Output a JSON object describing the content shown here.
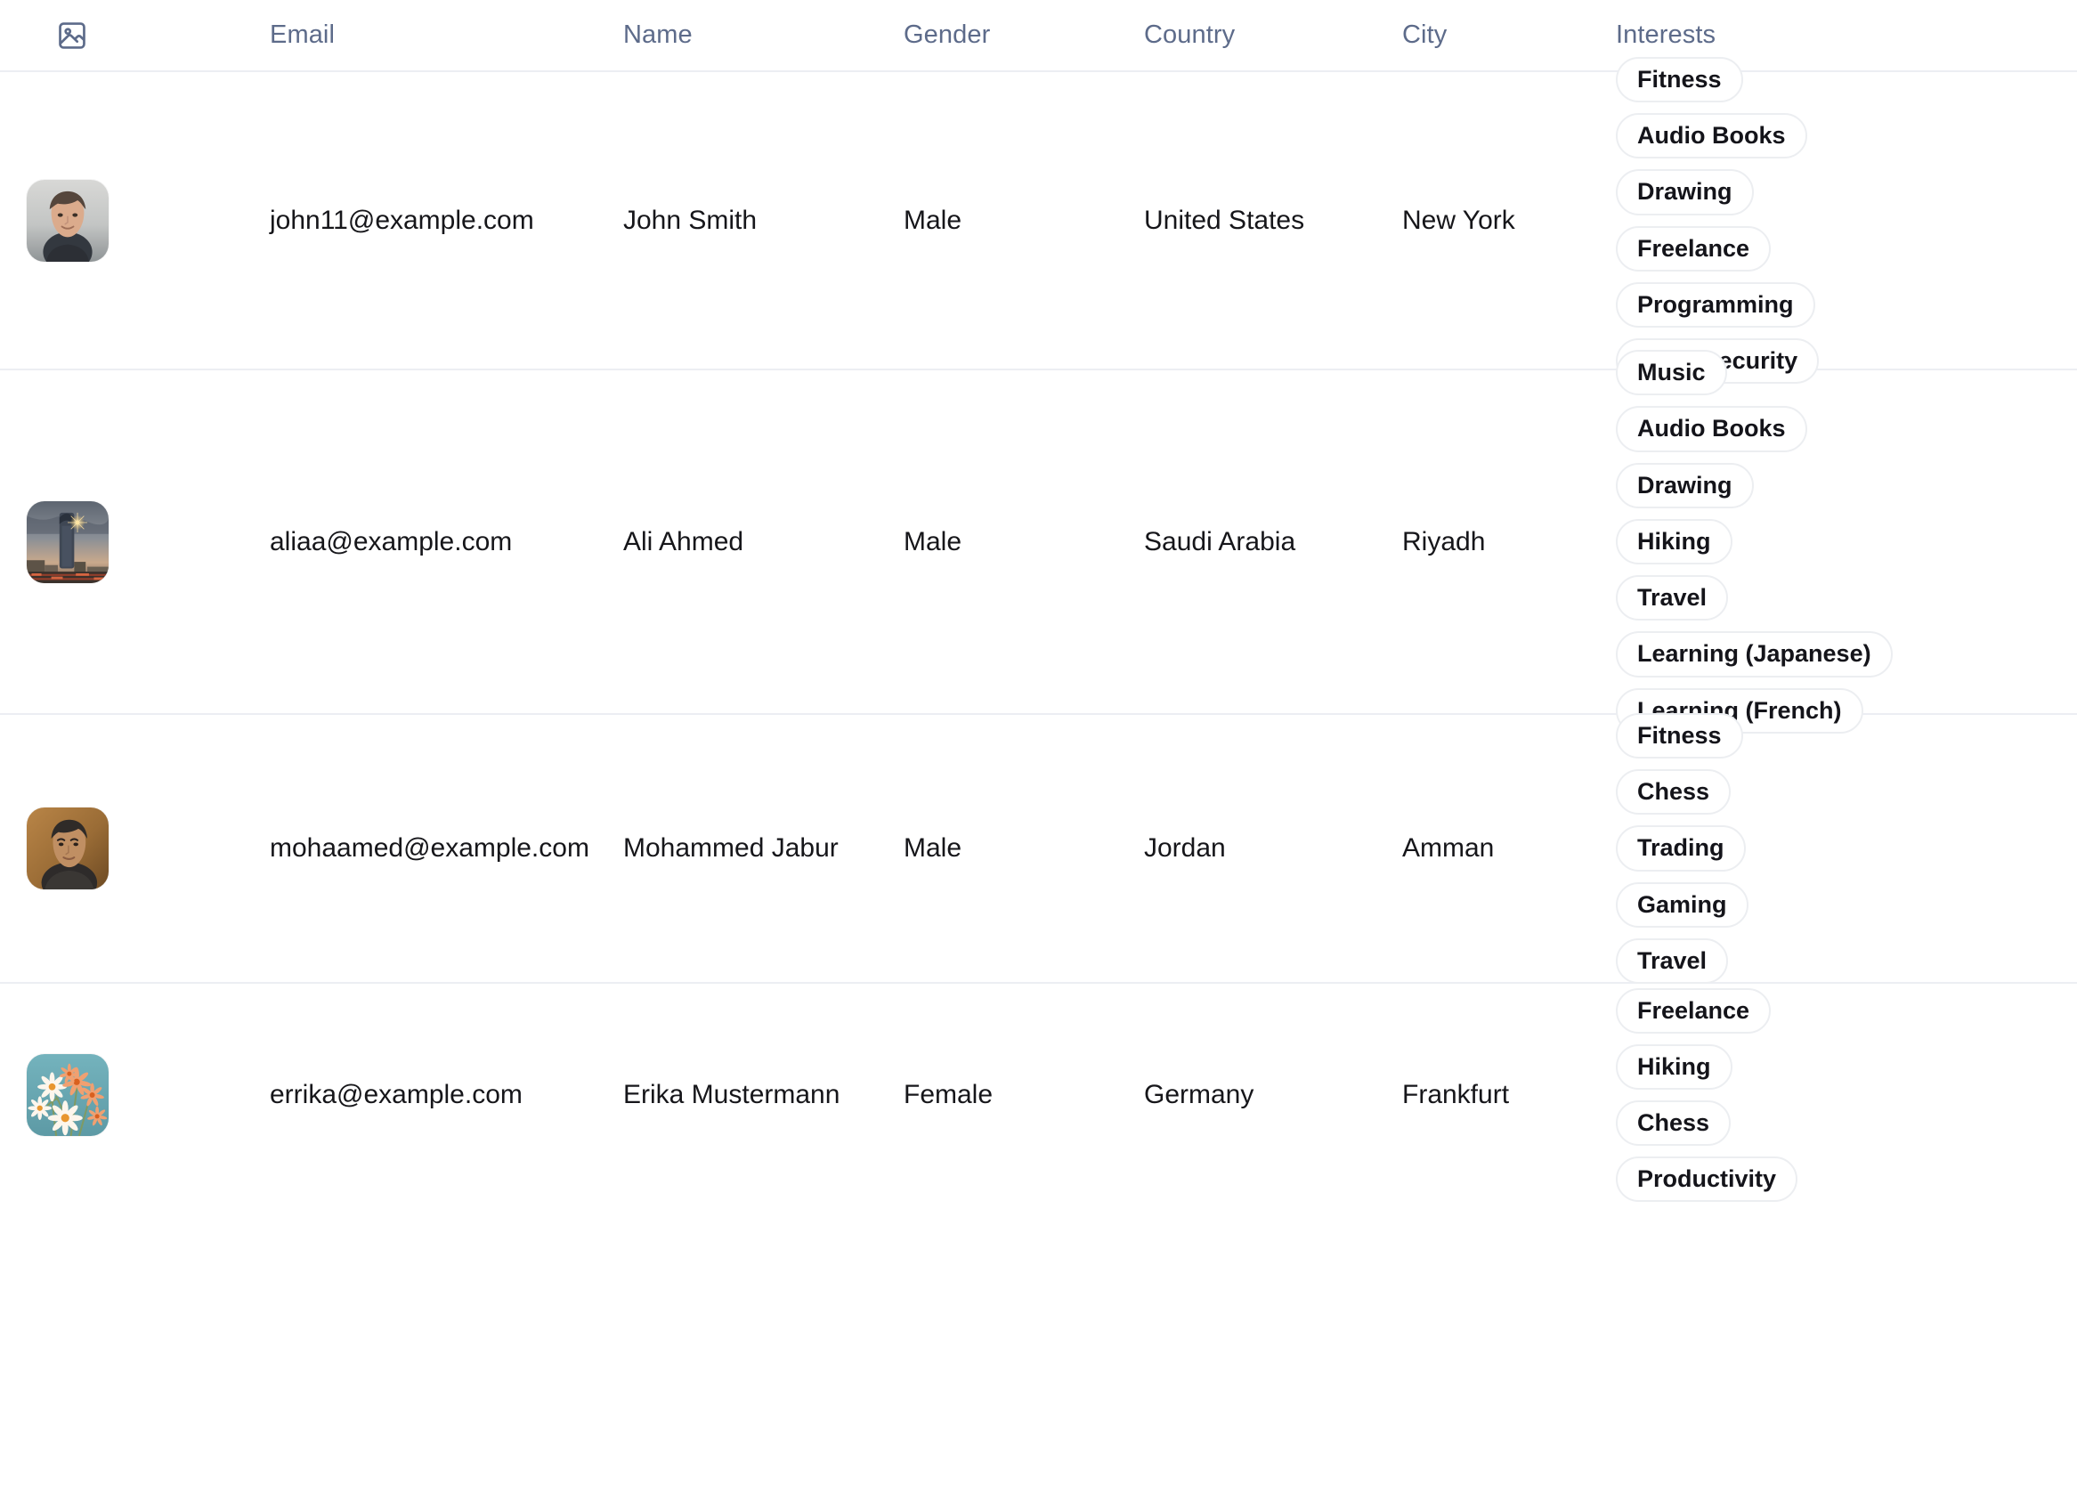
{
  "table": {
    "header_icon": "image-icon",
    "columns": [
      {
        "key": "image",
        "label": ""
      },
      {
        "key": "email",
        "label": "Email"
      },
      {
        "key": "name",
        "label": "Name"
      },
      {
        "key": "gender",
        "label": "Gender"
      },
      {
        "key": "country",
        "label": "Country"
      },
      {
        "key": "city",
        "label": "City"
      },
      {
        "key": "interests",
        "label": "Interests"
      }
    ],
    "colors": {
      "header_text": "#5d6b8a",
      "body_text": "#16161a",
      "row_divider": "#eceef3",
      "chip_border": "#eceef1",
      "background": "#ffffff"
    },
    "rows": [
      {
        "avatar": "portrait-man-gray-background",
        "email": "john11@example.com",
        "name": "John Smith",
        "gender": "Male",
        "country": "United States",
        "city": "New York",
        "interests": [
          "Fitness",
          "Audio Books",
          "Drawing",
          "Freelance",
          "Programming",
          "Cybersecurity"
        ]
      },
      {
        "avatar": "city-skyline-at-dusk",
        "email": "aliaa@example.com",
        "name": "Ali Ahmed",
        "gender": "Male",
        "country": "Saudi Arabia",
        "city": "Riyadh",
        "interests": [
          "Music",
          "Audio Books",
          "Drawing",
          "Hiking",
          "Travel",
          "Learning (Japanese)",
          "Learning (French)"
        ]
      },
      {
        "avatar": "portrait-man-brown-background",
        "email": "mohaamed@example.com",
        "name": "Mohammed Jabur",
        "gender": "Male",
        "country": "Jordan",
        "city": "Amman",
        "interests": [
          "Fitness",
          "Chess",
          "Trading",
          "Gaming",
          "Travel"
        ]
      },
      {
        "avatar": "daisy-flowers-teal-background",
        "email": "errika@example.com",
        "name": "Erika Mustermann",
        "gender": "Female",
        "country": "Germany",
        "city": "Frankfurt",
        "interests": [
          "Freelance",
          "Hiking",
          "Chess",
          "Productivity"
        ]
      }
    ]
  }
}
